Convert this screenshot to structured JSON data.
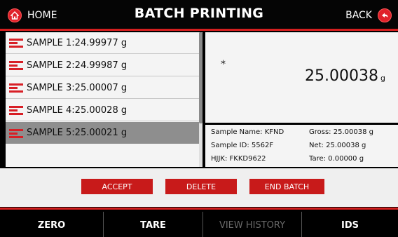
{
  "header": {
    "home_label": "HOME",
    "title": "BATCH PRINTING",
    "back_label": "BACK"
  },
  "samples": [
    {
      "label": "SAMPLE 1:24.99977 g",
      "selected": false
    },
    {
      "label": "SAMPLE 2:24.99987 g",
      "selected": false
    },
    {
      "label": "SAMPLE 3:25.00007 g",
      "selected": false
    },
    {
      "label": "SAMPLE 4:25.00028 g",
      "selected": false
    },
    {
      "label": "SAMPLE 5:25.00021 g",
      "selected": true
    }
  ],
  "weight": {
    "asterisk": "*",
    "value": "25.00038",
    "unit": "g"
  },
  "details": {
    "sample_name": "Sample Name: KFND",
    "sample_id": "Sample ID: 5562F",
    "hjjk": "HJJK: FKKD9622",
    "gross": "Gross: 25.00038 g",
    "net": "Net: 25.00038 g",
    "tare": "Tare: 0.00000 g"
  },
  "actions": {
    "accept": "ACCEPT",
    "delete": "DELETE",
    "end_batch": "END BATCH"
  },
  "bottom": {
    "zero": "ZERO",
    "tare": "TARE",
    "view_history": "VIEW HISTORY",
    "ids": "IDS"
  },
  "colors": {
    "accent": "#d41f1f",
    "button": "#c81a1a",
    "selected_row": "#8e8e8e"
  }
}
